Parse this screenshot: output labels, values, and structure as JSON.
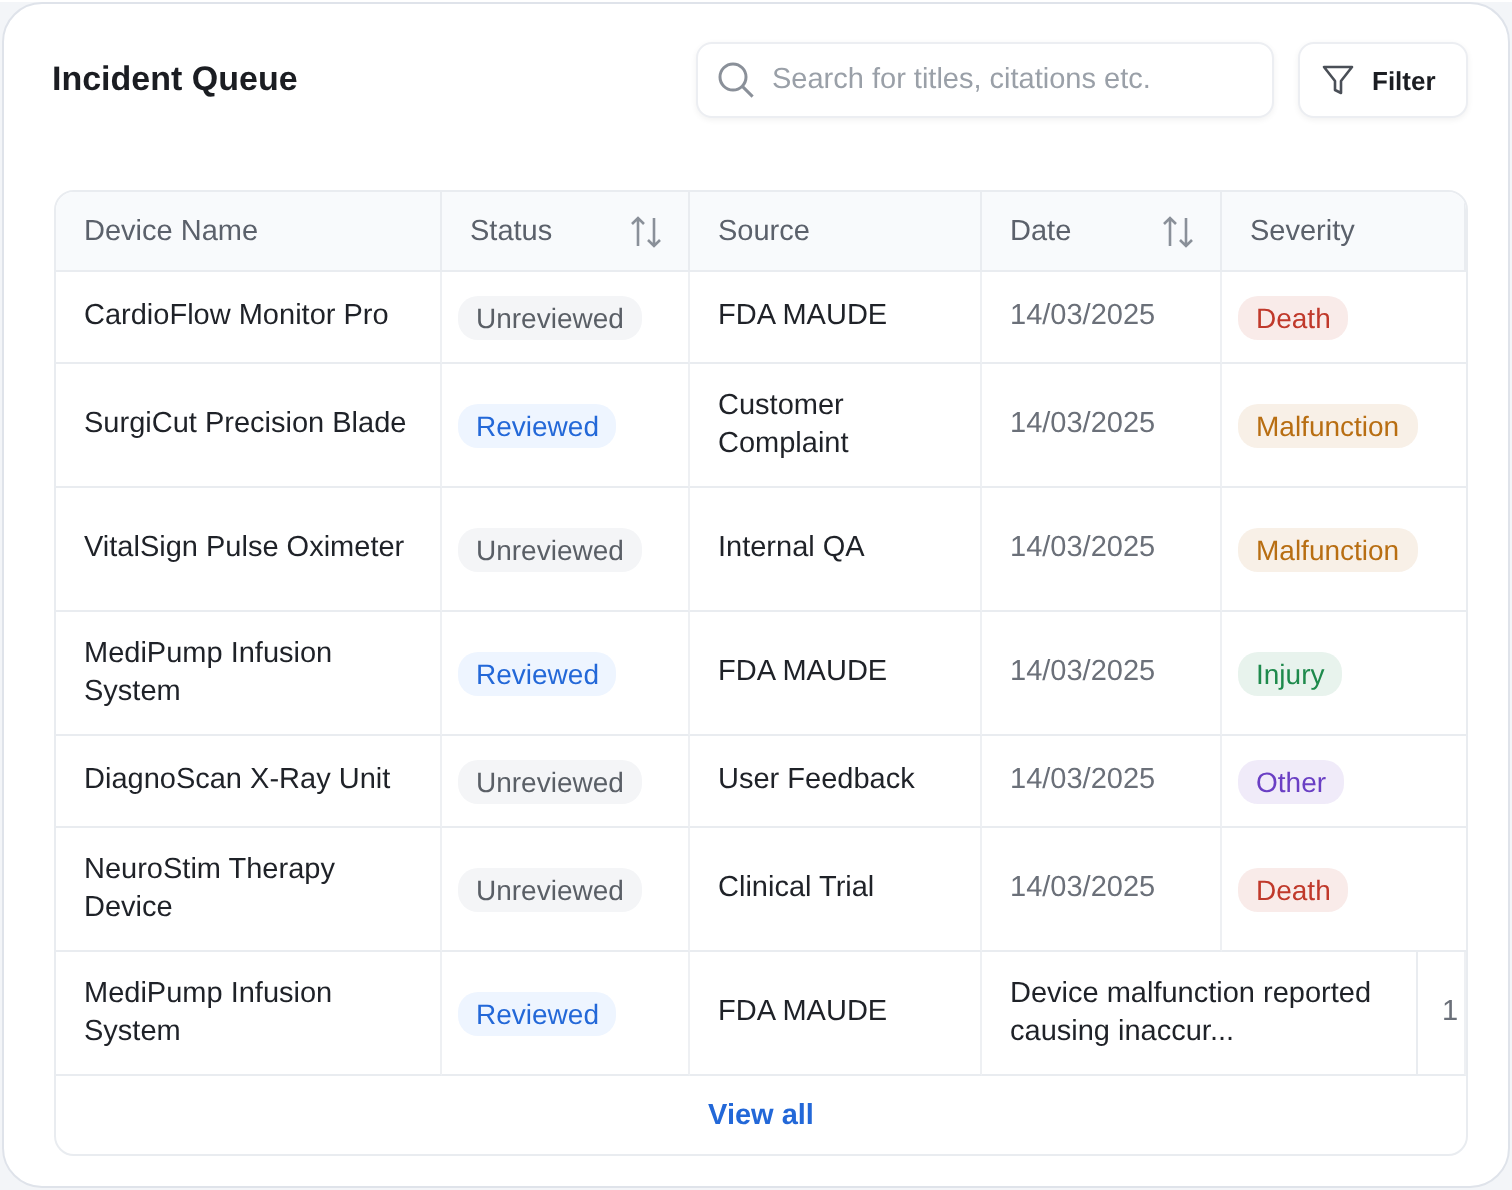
{
  "title": "Incident Queue",
  "search": {
    "placeholder": "Search for titles, citations etc."
  },
  "filter_button": "Filter",
  "table": {
    "columns": [
      {
        "label": "Device Name",
        "sortable": false
      },
      {
        "label": "Status",
        "sortable": true
      },
      {
        "label": "Source",
        "sortable": false
      },
      {
        "label": "Date",
        "sortable": true
      },
      {
        "label": "Severity",
        "sortable": false
      }
    ],
    "rows": [
      {
        "device": "CardioFlow Monitor Pro",
        "status": {
          "label": "Unreviewed",
          "reviewed": false
        },
        "source": "FDA MAUDE",
        "date": "14/03/2025",
        "severity": {
          "label": "Death",
          "color": "#c0392b"
        }
      },
      {
        "device": "SurgiCut Precision Blade",
        "status": {
          "label": "Reviewed",
          "reviewed": true
        },
        "source": "Customer Complaint",
        "date": "14/03/2025",
        "severity": {
          "label": "Malfunction",
          "color": "#b86e12"
        }
      },
      {
        "device": "VitalSign Pulse Oximeter",
        "status": {
          "label": "Unreviewed",
          "reviewed": false
        },
        "source": "Internal QA",
        "date": "14/03/2025",
        "severity": {
          "label": "Malfunction",
          "color": "#b86e12"
        }
      },
      {
        "device": "MediPump Infusion System",
        "status": {
          "label": "Reviewed",
          "reviewed": true
        },
        "source": "FDA MAUDE",
        "date": "14/03/2025",
        "severity": {
          "label": "Injury",
          "color": "#1e8a4c"
        }
      },
      {
        "device": "DiagnoScan X-Ray Unit",
        "status": {
          "label": "Unreviewed",
          "reviewed": false
        },
        "source": "User Feedback",
        "date": "14/03/2025",
        "severity": {
          "label": "Other",
          "color": "#6a3fc4"
        }
      },
      {
        "device": "NeuroStim Therapy Device",
        "status": {
          "label": "Unreviewed",
          "reviewed": false
        },
        "source": "Clinical Trial",
        "date": "14/03/2025",
        "severity": {
          "label": "Death",
          "color": "#c0392b"
        }
      },
      {
        "device": "MediPump Infusion System",
        "status": {
          "label": "Reviewed",
          "reviewed": true
        },
        "source": "FDA MAUDE",
        "description": "Device malfunction reported causing inaccur...",
        "column_6": "1"
      }
    ],
    "view_all": "View all"
  }
}
